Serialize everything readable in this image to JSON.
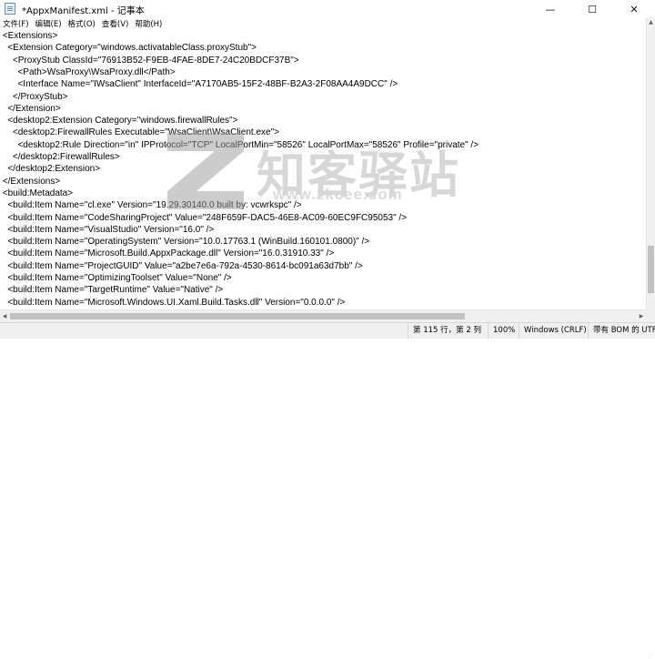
{
  "window": {
    "title": "*AppxManifest.xml - 记事本",
    "minimize_glyph": "—",
    "maximize_glyph": "☐",
    "close_glyph": "✕"
  },
  "menu": [
    {
      "label": "文件(F)"
    },
    {
      "label": "编辑(E)"
    },
    {
      "label": "格式(O)"
    },
    {
      "label": "查看(V)"
    },
    {
      "label": "帮助(H)"
    }
  ],
  "editor": {
    "lines": [
      {
        "text": " <Extensions>"
      },
      {
        "text": "   <Extension Category=\"windows.activatableClass.proxyStub\">"
      },
      {
        "text": "     <ProxyStub ClassId=\"76913B52-F9EB-4FAE-8DE7-24C20BDCF37B\">"
      },
      {
        "text": "       <Path>WsaProxy\\WsaProxy.dll</Path>"
      },
      {
        "text": "       <Interface Name=\"IWsaClient\" InterfaceId=\"A7170AB5-15F2-48BF-B2A3-2F08AA4A9DCC\" />"
      },
      {
        "text": "     </ProxyStub>"
      },
      {
        "text": "   </Extension>"
      },
      {
        "text": "   <desktop2:Extension Category=\"windows.firewallRules\">"
      },
      {
        "text": "     <desktop2:FirewallRules Executable=\"WsaClient\\WsaClient.exe\">"
      },
      {
        "text": "       <desktop2:Rule Direction=\"in\" IPProtocol=\"TCP\" LocalPortMin=\"58526\" LocalPortMax=\"58526\" Profile=\"private\" />"
      },
      {
        "text": "     </desktop2:FirewallRules>"
      },
      {
        "text": "   </desktop2:Extension>"
      },
      {
        "text": " </Extensions>"
      },
      {
        "text": " <build:Metadata>"
      },
      {
        "text": "   <build:Item Name=\"cl.exe\" Version=\"19.29.30140.0 built by: vcwrkspc\" />"
      },
      {
        "text": "   <build:Item Name=\"CodeSharingProject\" Value=\"248F659F-DAC5-46E8-AC09-60EC9FC95053\" />"
      },
      {
        "text": "   <build:Item Name=\"VisualStudio\" Version=\"16.0\" />"
      },
      {
        "text": "   <build:Item Name=\"OperatingSystem\" Version=\"10.0.17763.1 (WinBuild.160101.0800)\" />"
      },
      {
        "text": "   <build:Item Name=\"Microsoft.Build.AppxPackage.dll\" Version=\"16.0.31910.33\" />"
      },
      {
        "text": "   <build:Item Name=\"ProjectGUID\" Value=\"a2be7e6a-792a-4530-8614-bc091a63d7bb\" />"
      },
      {
        "text": "   <build:Item Name=\"OptimizingToolset\" Value=\"None\" />"
      },
      {
        "text": "   <build:Item Name=\"TargetRuntime\" Value=\"Native\" />"
      },
      {
        "text": "   <build:Item Name=\"Microsoft.Windows.UI.Xaml.Build.Tasks.dll\" Version=\"0.0.0.0\" />"
      }
    ]
  },
  "statusbar": {
    "position": "第 115 行，第 2 列",
    "zoom": "100%",
    "line_ending": "Windows (CRLF)",
    "encoding": "带有 BOM 的 UTF"
  },
  "watermark": {
    "brand": "知客驿站",
    "url": "www.zkcee.com"
  }
}
